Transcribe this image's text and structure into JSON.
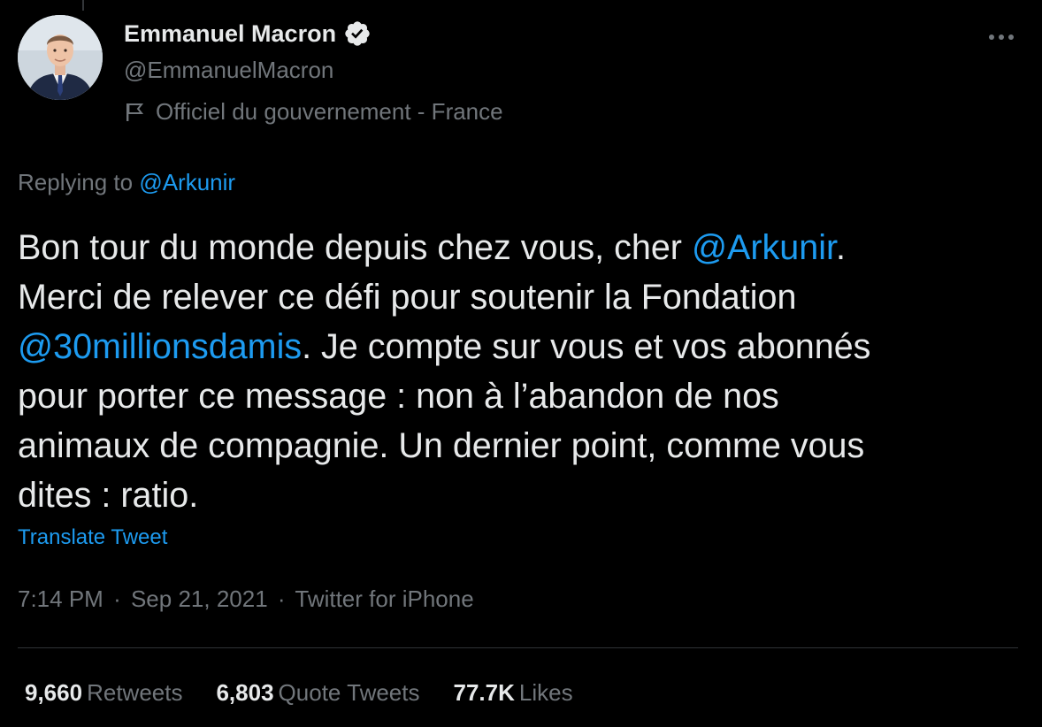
{
  "author": {
    "name": "Emmanuel Macron",
    "handle": "@EmmanuelMacron",
    "affiliation": "Officiel du gouvernement - France",
    "verified_icon": "verified-badge-icon",
    "avatar": "profile-photo"
  },
  "reply": {
    "prefix": "Replying to ",
    "mention": "@Arkunir"
  },
  "tweet": {
    "l1_a": "Bon tour du monde depuis chez vous, cher ",
    "l1_mention": "@Arkunir",
    "l1_b": ".",
    "l2": "Merci de relever ce défi pour soutenir la Fondation",
    "l3_mention": "@30millionsdamis",
    "l3_b": ". Je compte sur vous et vos abonnés",
    "l4": "pour porter ce message : non à l’abandon de nos",
    "l5": "animaux de compagnie. Un dernier point, comme vous",
    "l6": "dites : ratio."
  },
  "translate_label": "Translate Tweet",
  "meta": {
    "time": "7:14 PM",
    "separator": "·",
    "date": "Sep 21, 2021",
    "source": "Twitter for iPhone"
  },
  "stats": {
    "retweets_count": "9,660",
    "retweets_label": "Retweets",
    "quotes_count": "6,803",
    "quotes_label": "Quote Tweets",
    "likes_count": "77.7K",
    "likes_label": "Likes"
  },
  "colors": {
    "background": "#000000",
    "text": "#e7e9ea",
    "secondary": "#71767b",
    "link": "#1d9bf0",
    "divider": "#2f3336"
  }
}
